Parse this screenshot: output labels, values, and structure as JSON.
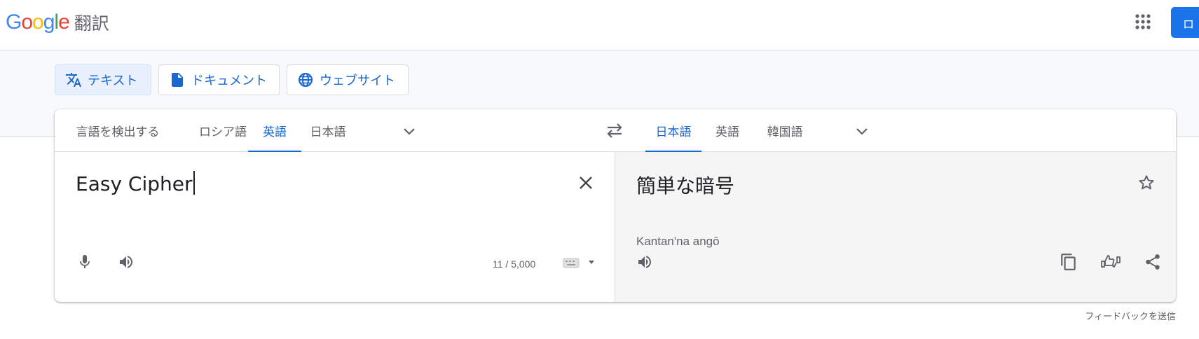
{
  "header": {
    "logo_letters": [
      "G",
      "o",
      "o",
      "g",
      "l",
      "e"
    ],
    "logo_colors": [
      "#4285f4",
      "#ea4335",
      "#fbbc05",
      "#4285f4",
      "#34a853",
      "#ea4335"
    ],
    "product_name": "翻訳",
    "apps_icon": "apps-grid-icon",
    "login_label": "ロ"
  },
  "modes": [
    {
      "label": "テキスト",
      "icon": "translate-icon",
      "active": true
    },
    {
      "label": "ドキュメント",
      "icon": "document-icon",
      "active": false
    },
    {
      "label": "ウェブサイト",
      "icon": "globe-icon",
      "active": false
    }
  ],
  "source_languages": [
    {
      "label": "言語を検出する",
      "active": false
    },
    {
      "label": "ロシア語",
      "active": false
    },
    {
      "label": "英語",
      "active": true
    },
    {
      "label": "日本語",
      "active": false
    }
  ],
  "target_languages": [
    {
      "label": "日本語",
      "active": true
    },
    {
      "label": "英語",
      "active": false
    },
    {
      "label": "韓国語",
      "active": false
    }
  ],
  "source": {
    "text": "Easy Cipher",
    "char_count": "11 / 5,000"
  },
  "target": {
    "text": "簡単な暗号",
    "transliteration": "Kantan'na angō"
  },
  "footer": {
    "feedback_label": "フィードバックを送信"
  },
  "colors": {
    "accent": "#1967d2",
    "brand_blue": "#1a73e8",
    "icon_gray": "#5f6368"
  }
}
